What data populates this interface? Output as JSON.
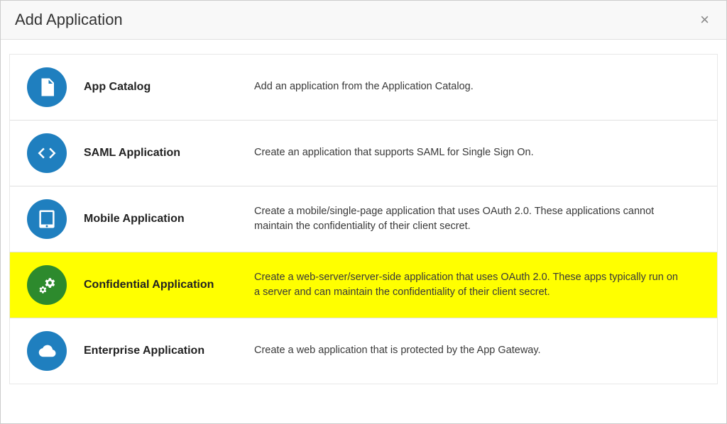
{
  "dialog": {
    "title": "Add Application",
    "close_symbol": "×"
  },
  "options": [
    {
      "label": "App Catalog",
      "description": "Add an application from the Application Catalog.",
      "highlighted": false
    },
    {
      "label": "SAML Application",
      "description": "Create an application that supports SAML for Single Sign On.",
      "highlighted": false
    },
    {
      "label": "Mobile Application",
      "description": "Create a mobile/single-page application that uses OAuth 2.0. These applications cannot maintain the confidentiality of their client secret.",
      "highlighted": false
    },
    {
      "label": "Confidential Application",
      "description": "Create a web-server/server-side application that uses OAuth 2.0. These apps typically run on a server and can maintain the confidentiality of their client secret.",
      "highlighted": true
    },
    {
      "label": "Enterprise Application",
      "description": "Create a web application that is protected by the App Gateway.",
      "highlighted": false
    }
  ]
}
